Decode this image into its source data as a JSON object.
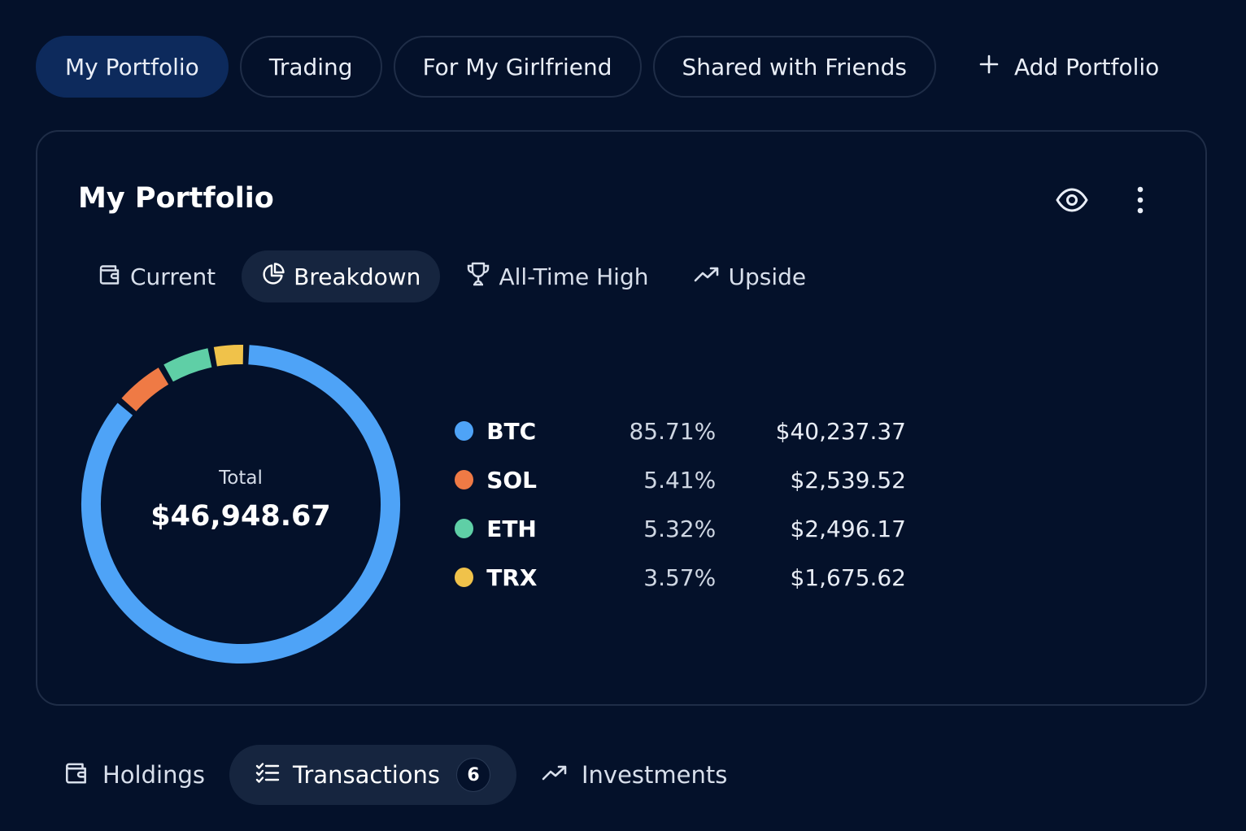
{
  "portfolio_tabs": [
    {
      "label": "My Portfolio",
      "active": true
    },
    {
      "label": "Trading",
      "active": false
    },
    {
      "label": "For My Girlfriend",
      "active": false
    },
    {
      "label": "Shared with Friends",
      "active": false
    }
  ],
  "add_portfolio": {
    "label": "Add Portfolio",
    "icon": "plus-icon"
  },
  "card": {
    "title": "My Portfolio",
    "actions": [
      {
        "name": "eye-icon"
      },
      {
        "name": "more-vertical-icon"
      }
    ],
    "view_tabs": [
      {
        "label": "Current",
        "icon": "wallet-icon",
        "active": false
      },
      {
        "label": "Breakdown",
        "icon": "pie-chart-icon",
        "active": true
      },
      {
        "label": "All-Time High",
        "icon": "trophy-icon",
        "active": false
      },
      {
        "label": "Upside",
        "icon": "trending-up-icon",
        "active": false
      }
    ],
    "donut": {
      "label": "Total",
      "total": "$46,948.67"
    }
  },
  "chart_data": {
    "type": "pie",
    "categories": [
      "BTC",
      "SOL",
      "ETH",
      "TRX"
    ],
    "values": [
      85.71,
      5.41,
      5.32,
      3.57
    ],
    "amounts": [
      "$40,237.37",
      "$2,539.52",
      "$2,496.17",
      "$1,675.62"
    ],
    "percent_labels": [
      "85.71%",
      "5.41%",
      "5.32%",
      "3.57%"
    ],
    "colors": [
      "#4ea3f7",
      "#ef7a45",
      "#5fcfa6",
      "#f0c24a"
    ],
    "center_label": "Total",
    "center_value": "$46,948.67"
  },
  "bottom_tabs": [
    {
      "label": "Holdings",
      "icon": "wallet-icon",
      "active": false
    },
    {
      "label": "Transactions",
      "icon": "list-check-icon",
      "active": true,
      "count": "6"
    },
    {
      "label": "Investments",
      "icon": "trending-up-icon",
      "active": false
    }
  ],
  "colors": {
    "background": "#04112a",
    "active_tab": "#0d2a5c",
    "active_pill": "#16253f",
    "border": "#1f2d47"
  }
}
